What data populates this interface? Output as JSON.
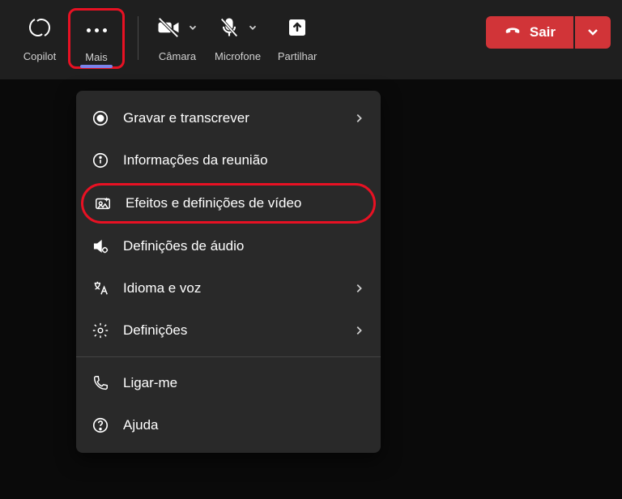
{
  "toolbar": {
    "copilot": {
      "label": "Copilot"
    },
    "more": {
      "label": "Mais"
    },
    "camera": {
      "label": "Câmara"
    },
    "microphone": {
      "label": "Microfone"
    },
    "share": {
      "label": "Partilhar"
    },
    "leave": {
      "label": "Sair"
    }
  },
  "menu": {
    "record": {
      "label": "Gravar e transcrever",
      "has_chevron": true
    },
    "info": {
      "label": "Informações da reunião",
      "has_chevron": false
    },
    "video_effects": {
      "label": "Efeitos e definições de vídeo",
      "has_chevron": false,
      "highlighted": true
    },
    "audio": {
      "label": "Definições de áudio",
      "has_chevron": false
    },
    "language": {
      "label": "Idioma e voz",
      "has_chevron": true
    },
    "settings": {
      "label": "Definições",
      "has_chevron": true
    },
    "call_me": {
      "label": "Ligar-me",
      "has_chevron": false
    },
    "help": {
      "label": "Ajuda",
      "has_chevron": false
    }
  }
}
